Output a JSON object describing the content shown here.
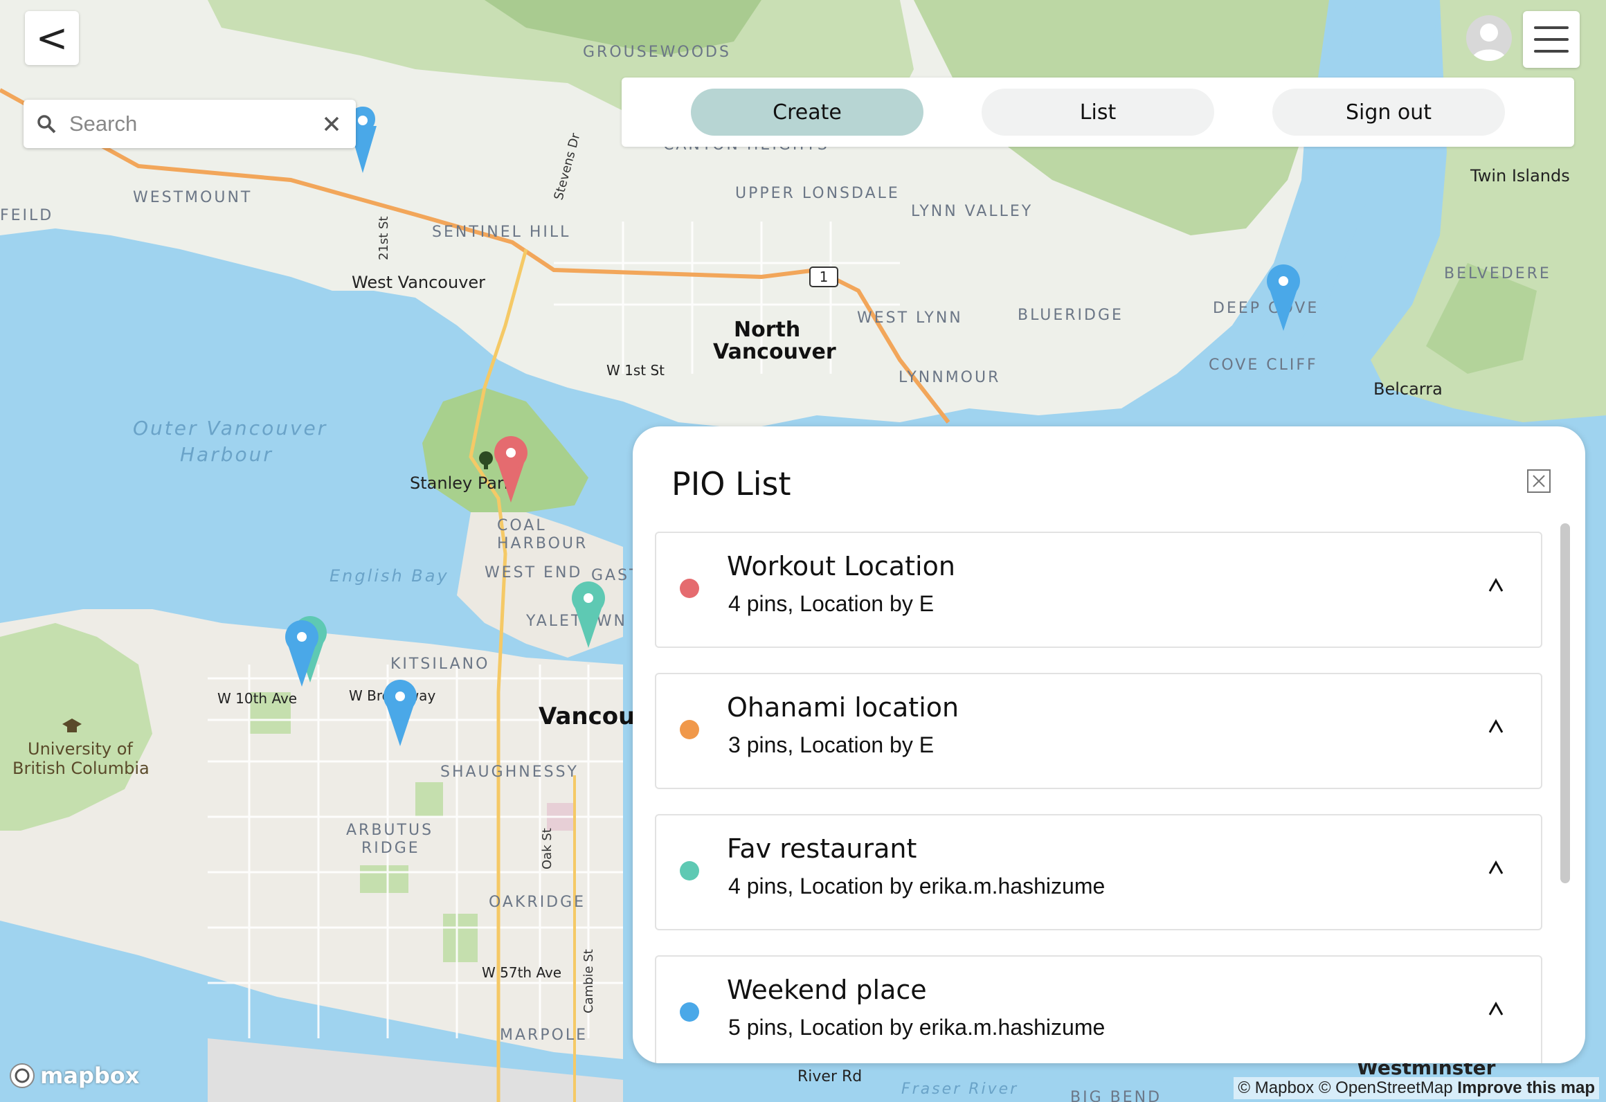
{
  "map": {
    "labels": {
      "grousewoods": "GROUSEWOODS",
      "canyon_heights": "CANYON HEIGHTS",
      "upper_lonsdale": "UPPER LONSDALE",
      "lynn_valley": "LYNN VALLEY",
      "westmount": "WESTMOUNT",
      "sentinel_hill": "SENTINEL HILL",
      "feild": "FEILD",
      "west_vancouver": "West Vancouver",
      "twenty_first": "21st St",
      "stevens": "Stevens Dr",
      "north_vancouver_1": "North",
      "north_vancouver_2": "Vancouver",
      "west_lynn": "WEST LYNN",
      "blueridge": "BLUERIDGE",
      "lynnmour": "LYNNMOUR",
      "deep_cove": "DEEP COVE",
      "cove_cliff": "COVE CLIFF",
      "belvedere": "BELVEDERE",
      "twin_islands": "Twin Islands",
      "belcarra": "Belcarra",
      "w1st": "W 1st St",
      "outer_harbour_1": "Outer Vancouver",
      "outer_harbour_2": "Harbour",
      "stanley_park": "Stanley Park",
      "coal_harbour_1": "COAL",
      "coal_harbour_2": "HARBOUR",
      "west_end": "WEST END",
      "gast": "GAST",
      "yaletown": "YALETOWN",
      "english_bay": "English Bay",
      "kitsilano": "KITSILANO",
      "w10th": "W 10th Ave",
      "wbroadway": "W Broadway",
      "vancouver": "Vancouv",
      "ubc_1": "University of",
      "ubc_2": "British Columbia",
      "shaughnessy": "SHAUGHNESSY",
      "arbutus_1": "ARBUTUS",
      "arbutus_2": "RIDGE",
      "oak_st": "Oak St",
      "oakridge": "OAKRIDGE",
      "w57th": "W 57th Ave",
      "cambie": "Cambie St",
      "marpole": "MARPOLE",
      "river_rd": "River Rd",
      "fraser_river": "Fraser River",
      "big_bend": "BIG BEND",
      "westminster": "Westminster",
      "hwy1": "1"
    },
    "pin_colors": {
      "red": "#e56b6f",
      "teal": "#5ec9b3",
      "blue": "#4aa8e8"
    }
  },
  "controls": {
    "back_label": "<",
    "search_placeholder": "Search"
  },
  "nav": {
    "create": "Create",
    "list": "List",
    "signout": "Sign out"
  },
  "panel": {
    "title": "PIO List",
    "items": [
      {
        "name": "Workout Location",
        "meta": "4 pins, Location by E",
        "color": "#e56b6f"
      },
      {
        "name": "Ohanami location",
        "meta": "3 pins, Location by E",
        "color": "#f0984a"
      },
      {
        "name": "Fav restaurant",
        "meta": "4 pins, Location by erika.m.hashizume",
        "color": "#5ec9b3"
      },
      {
        "name": "Weekend place",
        "meta": "5 pins, Location by erika.m.hashizume",
        "color": "#4aa8e8"
      }
    ]
  },
  "footer": {
    "mapbox": "mapbox",
    "attr_mapbox": "© Mapbox",
    "attr_osm": "© OpenStreetMap",
    "attr_improve": "Improve this map"
  }
}
